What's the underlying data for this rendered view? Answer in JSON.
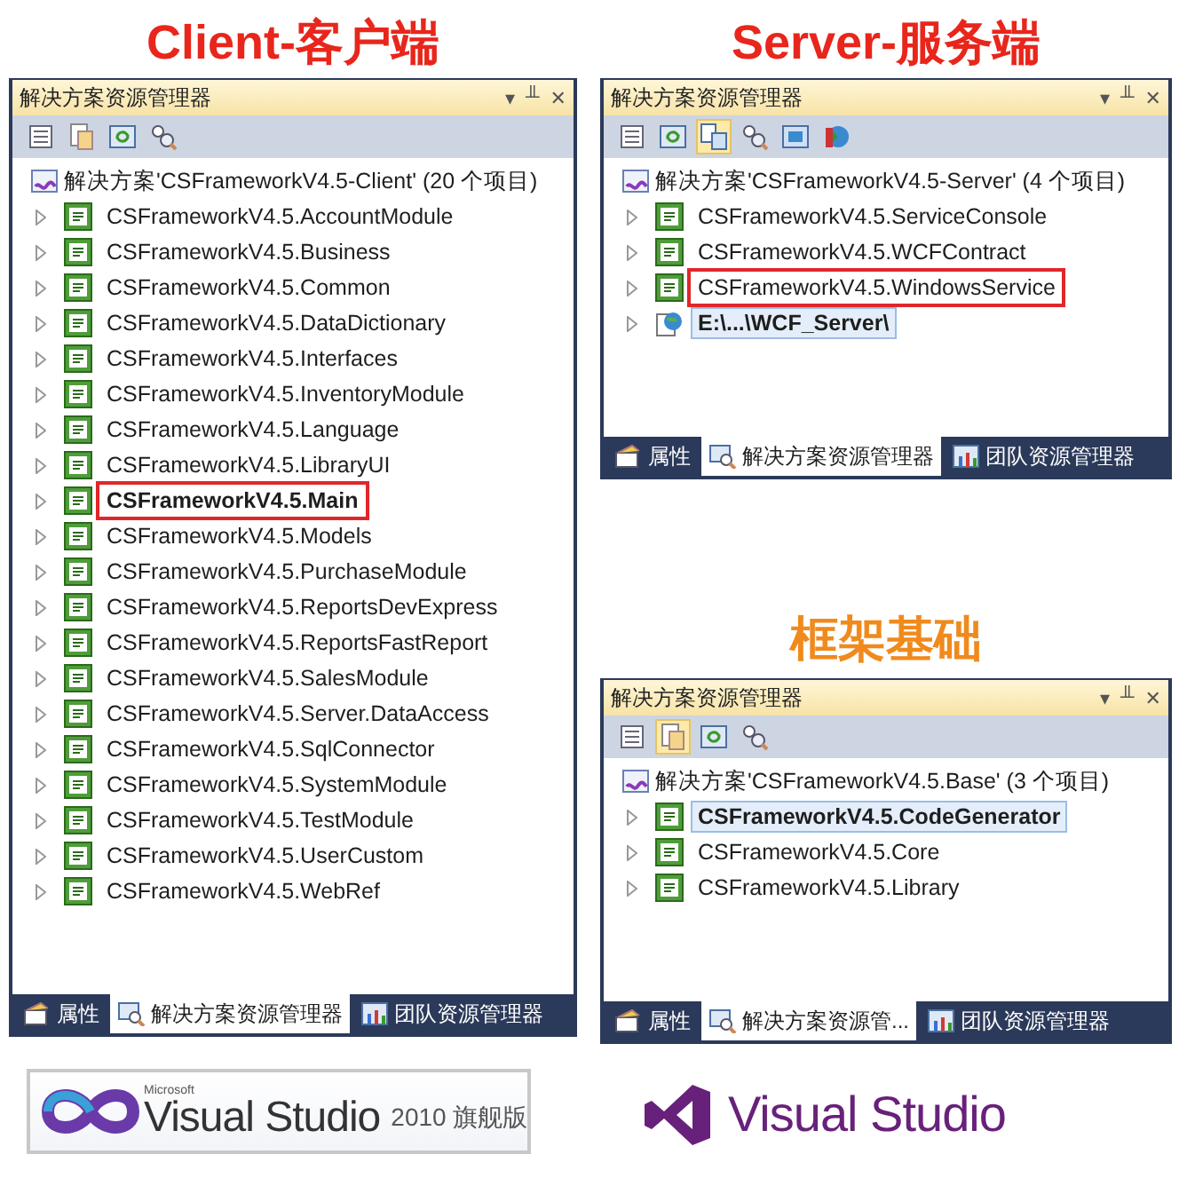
{
  "client": {
    "heading": "Client-客户端",
    "panel": {
      "title": "解决方案资源管理器",
      "controls": [
        "▾",
        "╨",
        "✕"
      ],
      "toolbar": [
        {
          "kind": "list",
          "pressed": false
        },
        {
          "kind": "showall",
          "pressed": false
        },
        {
          "kind": "refresh",
          "pressed": false
        },
        {
          "kind": "classview",
          "pressed": false
        }
      ],
      "solution": "解决方案'CSFrameworkV4.5-Client' (20 个项目)",
      "items": [
        {
          "kind": "csharp",
          "name": "CSFrameworkV4.5.AccountModule",
          "bold": false,
          "selected": false,
          "marked": false
        },
        {
          "kind": "csharp",
          "name": "CSFrameworkV4.5.Business",
          "bold": false,
          "selected": false,
          "marked": false
        },
        {
          "kind": "csharp",
          "name": "CSFrameworkV4.5.Common",
          "bold": false,
          "selected": false,
          "marked": false
        },
        {
          "kind": "csharp",
          "name": "CSFrameworkV4.5.DataDictionary",
          "bold": false,
          "selected": false,
          "marked": false
        },
        {
          "kind": "csharp",
          "name": "CSFrameworkV4.5.Interfaces",
          "bold": false,
          "selected": false,
          "marked": false
        },
        {
          "kind": "csharp",
          "name": "CSFrameworkV4.5.InventoryModule",
          "bold": false,
          "selected": false,
          "marked": false
        },
        {
          "kind": "csharp",
          "name": "CSFrameworkV4.5.Language",
          "bold": false,
          "selected": false,
          "marked": false
        },
        {
          "kind": "csharp",
          "name": "CSFrameworkV4.5.LibraryUI",
          "bold": false,
          "selected": false,
          "marked": false
        },
        {
          "kind": "csharp",
          "name": "CSFrameworkV4.5.Main",
          "bold": true,
          "selected": false,
          "marked": true
        },
        {
          "kind": "csharp",
          "name": "CSFrameworkV4.5.Models",
          "bold": false,
          "selected": false,
          "marked": false
        },
        {
          "kind": "csharp",
          "name": "CSFrameworkV4.5.PurchaseModule",
          "bold": false,
          "selected": false,
          "marked": false
        },
        {
          "kind": "csharp",
          "name": "CSFrameworkV4.5.ReportsDevExpress",
          "bold": false,
          "selected": false,
          "marked": false
        },
        {
          "kind": "csharp",
          "name": "CSFrameworkV4.5.ReportsFastReport",
          "bold": false,
          "selected": false,
          "marked": false
        },
        {
          "kind": "csharp",
          "name": "CSFrameworkV4.5.SalesModule",
          "bold": false,
          "selected": false,
          "marked": false
        },
        {
          "kind": "csharp",
          "name": "CSFrameworkV4.5.Server.DataAccess",
          "bold": false,
          "selected": false,
          "marked": false
        },
        {
          "kind": "csharp",
          "name": "CSFrameworkV4.5.SqlConnector",
          "bold": false,
          "selected": false,
          "marked": false
        },
        {
          "kind": "csharp",
          "name": "CSFrameworkV4.5.SystemModule",
          "bold": false,
          "selected": false,
          "marked": false
        },
        {
          "kind": "csharp",
          "name": "CSFrameworkV4.5.TestModule",
          "bold": false,
          "selected": false,
          "marked": false
        },
        {
          "kind": "csharp",
          "name": "CSFrameworkV4.5.UserCustom",
          "bold": false,
          "selected": false,
          "marked": false
        },
        {
          "kind": "csharp",
          "name": "CSFrameworkV4.5.WebRef",
          "bold": false,
          "selected": false,
          "marked": false
        }
      ],
      "tabs": [
        {
          "kind": "properties",
          "label": "属性",
          "selected": false
        },
        {
          "kind": "solution",
          "label": "解决方案资源管理器",
          "selected": true
        },
        {
          "kind": "team",
          "label": "团队资源管理器",
          "selected": false
        }
      ]
    }
  },
  "server": {
    "heading": "Server-服务端",
    "panel": {
      "title": "解决方案资源管理器",
      "controls": [
        "▾",
        "╨",
        "✕"
      ],
      "toolbar": [
        {
          "kind": "list",
          "pressed": false
        },
        {
          "kind": "refresh",
          "pressed": false
        },
        {
          "kind": "nested",
          "pressed": true
        },
        {
          "kind": "classview",
          "pressed": false
        },
        {
          "kind": "browser",
          "pressed": false
        },
        {
          "kind": "config",
          "pressed": false
        }
      ],
      "solution": "解决方案'CSFrameworkV4.5-Server' (4 个项目)",
      "items": [
        {
          "kind": "csharp",
          "name": "CSFrameworkV4.5.ServiceConsole",
          "bold": false,
          "selected": false,
          "marked": false
        },
        {
          "kind": "csharp",
          "name": "CSFrameworkV4.5.WCFContract",
          "bold": false,
          "selected": false,
          "marked": false
        },
        {
          "kind": "csharp",
          "name": "CSFrameworkV4.5.WindowsService",
          "bold": false,
          "selected": false,
          "marked": true
        },
        {
          "kind": "web",
          "name": "E:\\...\\WCF_Server\\",
          "bold": true,
          "selected": true,
          "marked": false
        }
      ],
      "tabs": [
        {
          "kind": "properties",
          "label": "属性",
          "selected": false
        },
        {
          "kind": "solution",
          "label": "解决方案资源管理器",
          "selected": true
        },
        {
          "kind": "team",
          "label": "团队资源管理器",
          "selected": false
        }
      ]
    }
  },
  "base": {
    "heading": "框架基础",
    "panel": {
      "title": "解决方案资源管理器",
      "controls": [
        "▾",
        "╨",
        "✕"
      ],
      "toolbar": [
        {
          "kind": "list",
          "pressed": false
        },
        {
          "kind": "showall",
          "pressed": true
        },
        {
          "kind": "refresh",
          "pressed": false
        },
        {
          "kind": "classview",
          "pressed": false
        }
      ],
      "solution": "解决方案'CSFrameworkV4.5.Base' (3 个项目)",
      "items": [
        {
          "kind": "csharp",
          "name": "CSFrameworkV4.5.CodeGenerator",
          "bold": true,
          "selected": true,
          "marked": false
        },
        {
          "kind": "csharp",
          "name": "CSFrameworkV4.5.Core",
          "bold": false,
          "selected": false,
          "marked": false
        },
        {
          "kind": "csharp",
          "name": "CSFrameworkV4.5.Library",
          "bold": false,
          "selected": false,
          "marked": false
        }
      ],
      "tabs": [
        {
          "kind": "properties",
          "label": "属性",
          "selected": false
        },
        {
          "kind": "solution",
          "label": "解决方案资源管...",
          "selected": true
        },
        {
          "kind": "team",
          "label": "团队资源管理器",
          "selected": false
        }
      ]
    }
  },
  "logos": [
    {
      "kind": "vs2010",
      "maker": "Microsoft",
      "name": "Visual Studio",
      "edition": "2010 旗舰版"
    },
    {
      "kind": "vs",
      "name": "Visual Studio"
    }
  ]
}
